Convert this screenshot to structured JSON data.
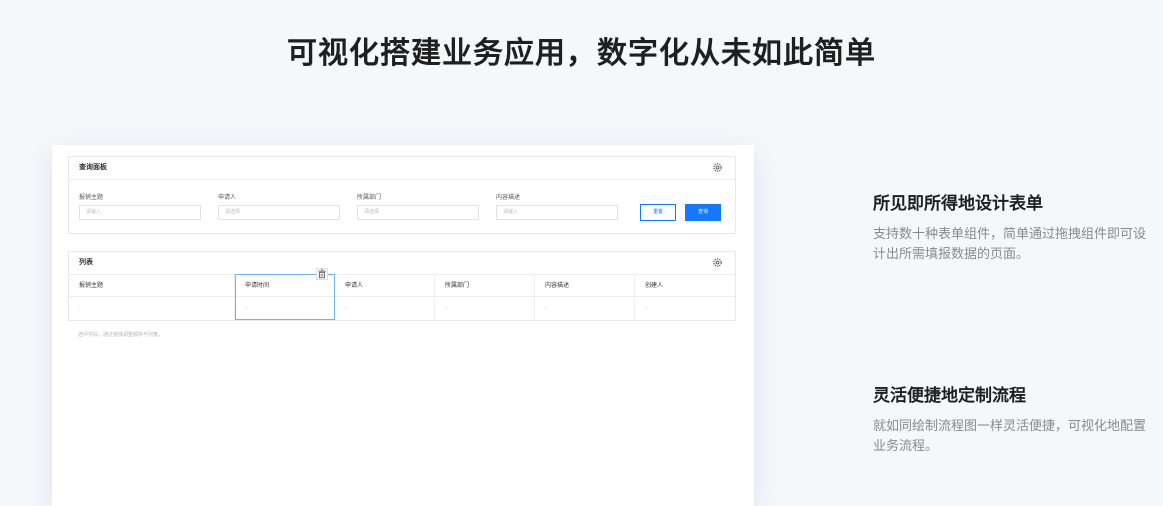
{
  "title": "可视化搭建业务应用，数字化从未如此简单",
  "mock": {
    "query_panel": {
      "title": "查询面板",
      "fields": [
        {
          "label": "报销主题",
          "placeholder": "请输入"
        },
        {
          "label": "申请人",
          "placeholder": "请选择"
        },
        {
          "label": "所属部门",
          "placeholder": "请选择"
        },
        {
          "label": "内容描述",
          "placeholder": "请输入"
        }
      ],
      "reset_label": "重置",
      "query_label": "查询"
    },
    "list_panel": {
      "title": "列表",
      "columns": [
        "报销主题",
        "申请时间",
        "申请人",
        "所属部门",
        "内容描述",
        "创建人"
      ],
      "row": [
        "-",
        "-",
        "-",
        "-",
        "-",
        "-"
      ],
      "hint": "选中字段，通过拖拽调整顺序与列宽。"
    }
  },
  "features": [
    {
      "title": "所见即所得地设计表单",
      "desc": "支持数十种表单组件，简单通过拖拽组件即可设计出所需填报数据的页面。"
    },
    {
      "title": "灵活便捷地定制流程",
      "desc": "就如同绘制流程图一样灵活便捷，可视化地配置业务流程。"
    }
  ],
  "colors": {
    "accent": "#1677ff",
    "background": "#f5f7fb"
  }
}
